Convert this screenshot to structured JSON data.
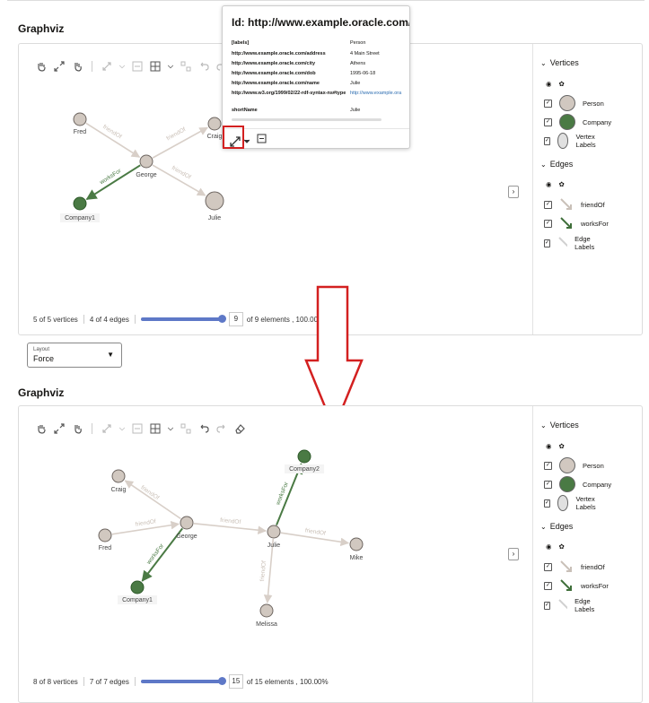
{
  "top": {
    "title": "Graphviz",
    "graph": {
      "nodes": [
        {
          "name": "Fred",
          "type": "Person"
        },
        {
          "name": "Craig",
          "type": "Person"
        },
        {
          "name": "George",
          "type": "Person"
        },
        {
          "name": "Company1",
          "type": "Company"
        },
        {
          "name": "Julie",
          "type": "Person"
        }
      ],
      "edges": [
        {
          "label": "friendOf"
        },
        {
          "label": "friendOf"
        },
        {
          "label": "worksFor"
        },
        {
          "label": "friendOf"
        }
      ]
    },
    "footer": {
      "vertices": "5 of 5 vertices",
      "edges": "4 of 4 edges",
      "count": "9",
      "elements": "of 9 elements , 100.00%"
    },
    "popup": {
      "title": "Id: http://www.example.oracle.com/J...",
      "props": [
        {
          "key": "[labels]",
          "value": "Person"
        },
        {
          "key": "http://www.example.oracle.com/address",
          "value": "4 Main Street"
        },
        {
          "key": "http://www.example.oracle.com/city",
          "value": "Athens"
        },
        {
          "key": "http://www.example.oracle.com/dob",
          "value": "1995-06-18"
        },
        {
          "key": "http://www.example.oracle.com/name",
          "value": "Julie"
        },
        {
          "key": "http://www.w3.org/1999/02/22-rdf-syntax-ns#type",
          "value": "http://www.example.ora"
        },
        {
          "key": "shortName",
          "value": "Julie"
        }
      ]
    },
    "layout": {
      "label": "Layout",
      "value": "Force"
    }
  },
  "bottom": {
    "title": "Graphviz",
    "graph": {
      "nodes": [
        {
          "name": "Craig",
          "type": "Person"
        },
        {
          "name": "Fred",
          "type": "Person"
        },
        {
          "name": "George",
          "type": "Person"
        },
        {
          "name": "Company1",
          "type": "Company"
        },
        {
          "name": "Julie",
          "type": "Person"
        },
        {
          "name": "Company2",
          "type": "Company"
        },
        {
          "name": "Mike",
          "type": "Person"
        },
        {
          "name": "Melissa",
          "type": "Person"
        }
      ],
      "edges": [
        {
          "label": "friendOf"
        },
        {
          "label": "friendOf"
        },
        {
          "label": "friendOf"
        },
        {
          "label": "worksFor"
        },
        {
          "label": "worksFor"
        },
        {
          "label": "friendOf"
        },
        {
          "label": "friendOf"
        }
      ]
    },
    "footer": {
      "vertices": "8 of 8 vertices",
      "edges": "7 of 7 edges",
      "count": "15",
      "elements": "of 15 elements , 100.00%"
    }
  },
  "legend": {
    "vertices_header": "Vertices",
    "vertices": [
      {
        "label": "Person",
        "color": "#d1c8c0"
      },
      {
        "label": "Company",
        "color": "#4a7a44"
      },
      {
        "label": "Vertex Labels",
        "color": "#e0e0e0"
      }
    ],
    "edges_header": "Edges",
    "edges": [
      {
        "label": "friendOf",
        "color": "#c9c0b8"
      },
      {
        "label": "worksFor",
        "color": "#3f6f3a"
      },
      {
        "label": "Edge Labels",
        "color": "#d0d0d0"
      }
    ]
  },
  "colors": {
    "person": "#d1c8c0",
    "company": "#4a7a44",
    "edge": "#d8cfc8",
    "works": "#4a7a44",
    "accent": "#5e78c7",
    "highlight": "#d32020"
  }
}
